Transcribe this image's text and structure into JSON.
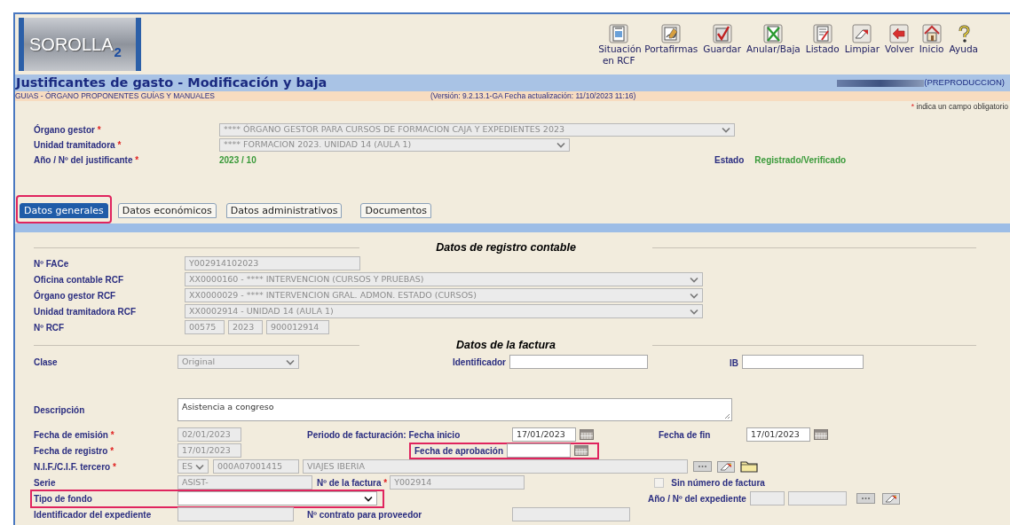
{
  "logo": {
    "text": "SOROLLA",
    "suffix": "2"
  },
  "toolbar": [
    {
      "label": "Situación en RCF"
    },
    {
      "label": "Portafirmas"
    },
    {
      "label": "Guardar"
    },
    {
      "label": "Anular/Baja"
    },
    {
      "label": "Listado"
    },
    {
      "label": "Limpiar"
    },
    {
      "label": "Volver"
    },
    {
      "label": "Inicio"
    },
    {
      "label": "Ayuda"
    }
  ],
  "title": "Justificantes de gasto - Modificación y baja",
  "environment": "(PREPRODUCCION)",
  "breadcrumb": "GUIAS - ÓRGANO PROPONENTES GUÍAS Y MANUALES",
  "version": "(Versión: 9.2.13.1-GA Fecha actualización: 11/10/2023 11:16)",
  "required_mark": "*",
  "required_note": "indica un campo obligatorio",
  "header_fields": {
    "organo_gestor": {
      "label": "Órgano gestor",
      "required": true,
      "field": {
        "kind": "select",
        "value": "**** ÓRGANO GESTOR PARA CURSOS DE FORMACION CAJA Y EXPEDIENTES 2023",
        "disabled": true
      }
    },
    "unidad_tramitadora": {
      "label": "Unidad tramitadora",
      "required": true,
      "field": {
        "kind": "select",
        "value": "**** FORMACION 2023. UNIDAD 14 (AULA 1)",
        "disabled": true
      }
    },
    "justificante": {
      "label": "Año / Nº del justificante",
      "required": true,
      "value": "2023 / 10"
    },
    "estado": {
      "label": "Estado",
      "value": "Registrado/Verificado"
    }
  },
  "tabs": [
    {
      "label": "Datos generales",
      "selected": true,
      "highlighted": true
    },
    {
      "label": "Datos económicos",
      "selected": false,
      "highlighted": false
    },
    {
      "label": "Datos administrativos",
      "selected": false,
      "highlighted": false
    },
    {
      "label": "Documentos",
      "selected": false,
      "highlighted": false
    }
  ],
  "registro": {
    "title": "Datos de registro contable",
    "face": {
      "label": "Nº FACe",
      "field": {
        "kind": "input",
        "value": "Y002914102023",
        "disabled": true
      }
    },
    "oficina": {
      "label": "Oficina contable RCF",
      "field": {
        "kind": "select",
        "value": "XX0000160 - **** INTERVENCION (CURSOS Y PRUEBAS)",
        "disabled": true
      }
    },
    "organo": {
      "label": "Órgano gestor RCF",
      "field": {
        "kind": "select",
        "value": "XX0000029 - **** INTERVENCION GRAL. ADMON. ESTADO (CURSOS)",
        "disabled": true
      }
    },
    "unidad": {
      "label": "Unidad tramitadora RCF",
      "field": {
        "kind": "select",
        "value": "XX0002914 - UNIDAD 14 (AULA 1)",
        "disabled": true
      }
    },
    "rcf": {
      "label": "Nº RCF",
      "fields": [
        {
          "kind": "input",
          "value": "00575",
          "disabled": true
        },
        {
          "kind": "input",
          "value": "2023",
          "disabled": true
        },
        {
          "kind": "input",
          "value": "900012914",
          "disabled": true
        }
      ]
    }
  },
  "factura": {
    "title": "Datos de la factura",
    "clase": {
      "label": "Clase",
      "required": false,
      "field": {
        "kind": "select",
        "value": "Original",
        "disabled": true
      }
    },
    "identificador": {
      "label": "Identificador",
      "required": false,
      "field": {
        "kind": "input",
        "disabled": false
      }
    },
    "ib": {
      "label": "IB",
      "required": false,
      "field": {
        "kind": "input",
        "disabled": false
      }
    },
    "descripcion": {
      "label": "Descripción",
      "required": false,
      "field": {
        "kind": "textarea",
        "value": "Asistencia a congreso",
        "disabled": false
      }
    },
    "fecha_emision": {
      "label": "Fecha de emisión",
      "required": true,
      "field": {
        "kind": "input",
        "value": "02/01/2023",
        "disabled": true
      }
    },
    "fecha_inicio": {
      "label": "Periodo de facturación: Fecha inicio",
      "required": false,
      "field": {
        "kind": "input",
        "value": "17/01/2023",
        "disabled": false
      }
    },
    "fecha_fin": {
      "label": "Fecha de fin",
      "required": false,
      "field": {
        "kind": "input",
        "value": "17/01/2023",
        "disabled": false
      }
    },
    "fecha_registro": {
      "label": "Fecha de registro",
      "required": true,
      "field": {
        "kind": "input",
        "value": "17/01/2023",
        "disabled": true
      }
    },
    "fecha_aprobacion": {
      "label": "Fecha de aprobación",
      "required": false,
      "highlighted": true,
      "field": {
        "kind": "input",
        "disabled": false
      }
    },
    "nif": {
      "label": "N.I.F./C.I.F. tercero",
      "required": true,
      "fields": [
        {
          "kind": "select",
          "value": "ES",
          "disabled": true
        },
        {
          "kind": "input",
          "value": "000A07001415",
          "disabled": true
        },
        {
          "kind": "input",
          "value": "VIAJES IBERIA",
          "disabled": true
        }
      ]
    },
    "serie": {
      "label": "Serie",
      "required": false,
      "field": {
        "kind": "input",
        "value": "ASIST-",
        "disabled": true
      }
    },
    "numero_factura": {
      "label": "Nº de la factura",
      "required": true,
      "field": {
        "kind": "input",
        "value": "Y002914",
        "disabled": true
      }
    },
    "sin_numero": {
      "label": "Sin número de factura",
      "checked": false
    },
    "tipo_fondo": {
      "label": "Tipo de fondo",
      "required": false,
      "highlighted": true,
      "field": {
        "kind": "select",
        "disabled": false
      }
    },
    "expediente": {
      "label": "Año / Nº del expediente",
      "required": false,
      "fields": [
        {
          "kind": "input",
          "disabled": true
        },
        {
          "kind": "input",
          "disabled": true
        }
      ]
    },
    "identificador_expediente": {
      "label": "Identificador del expediente",
      "required": false,
      "field": {
        "kind": "input",
        "disabled": true
      }
    },
    "contrato": {
      "label": "Nº contrato para proveedor",
      "required": false,
      "field": {
        "kind": "input",
        "disabled": true
      }
    }
  }
}
